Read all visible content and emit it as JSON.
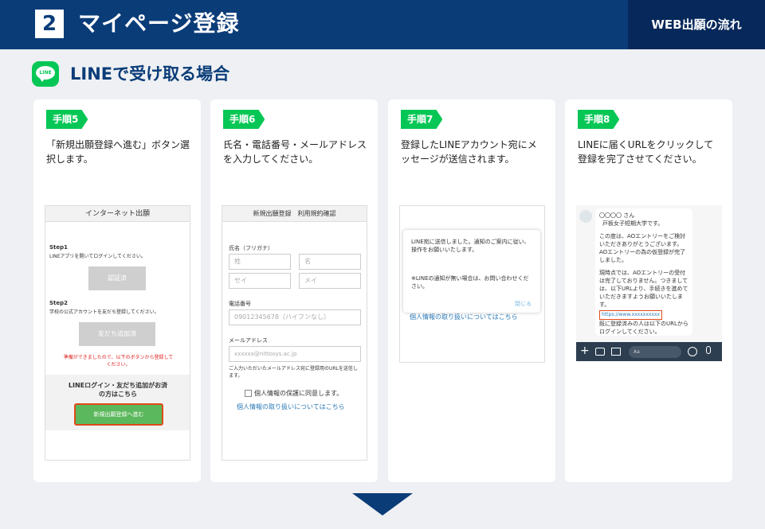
{
  "header": {
    "step_number": "2",
    "title": "マイページ登録",
    "flow_label": "WEB出願の流れ"
  },
  "section": {
    "line_icon": "LINE",
    "title": "LINEで受け取る場合"
  },
  "steps": [
    {
      "badge": "手順5",
      "desc": "「新規出願登録へ進む」ボタン選択します。",
      "shot": {
        "title": "インターネット出願",
        "step1": "Step1",
        "step1_text": "LINEアプリを開いてログインしてください。",
        "btn1": "認証済",
        "step2": "Step2",
        "step2_text": "学校の公式アカウントを友だち登録してください。",
        "btn2": "友だち追加済",
        "notice": "準備ができましたので、以下のボタンから登録してください。",
        "prompt": "LINEログイン・友だち追加がお済の方はこちら",
        "proceed": "新規出願登録へ進む"
      }
    },
    {
      "badge": "手順6",
      "desc": "氏名・電話番号・メールアドレスを入力してください。",
      "shot": {
        "title": "新規出願登録　利用規約確認",
        "name_label": "氏名（フリガナ）",
        "last_name": "姓",
        "first_name": "名",
        "last_kana": "セイ",
        "first_kana": "メイ",
        "phone_label": "電話番号",
        "phone_ph": "09012345678（ハイフンなし）",
        "mail_label": "メールアドレス",
        "mail_ph": "xxxxxx@nittosys.ac.jp",
        "mail_note": "ご入力いただいたメールアドレス宛に登録用のURLを送信します。",
        "agree": "個人情報の保護に同意します。",
        "privacy_link": "個人情報の取り扱いについてはこちら"
      }
    },
    {
      "badge": "手順7",
      "desc": "登録したLINEアカウント宛にメッセージが送信されます。",
      "shot": {
        "dialog_text": "LINE宛に送信しました。通知のご案内に従い、操作をお願いいたします。",
        "dialog_note": "※LINEの通知が無い場合は、お問い合わせください。",
        "close": "閉じる",
        "behind_link": "個人情報の取り扱いについてはこちら"
      }
    },
    {
      "badge": "手順8",
      "desc": "LINEに届くURLをクリックして登録を完了させてください。",
      "shot": {
        "name": "〇〇〇〇 さん",
        "school": "戸板女子短期大学です。",
        "p1": "この度は、AOエントリーをご検討いただきありがとうございます。AOエントリーの為の仮登録が完了しました。",
        "p2": "現時点では、AOエントリーの受付は完了しておりません。つきましては、以下URLより、手続きを進めていただきますようお願いいたします。",
        "url": "https://www.xxxxxxxxxx",
        "p3": "既に登録済みの人は以下のURLからログインしてください。",
        "input_ph": "Aa"
      }
    }
  ]
}
